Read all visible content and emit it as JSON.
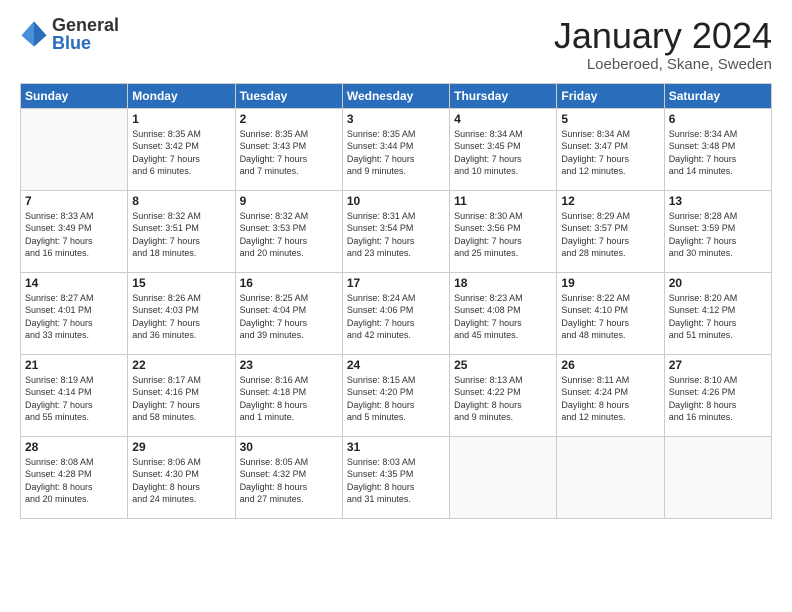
{
  "header": {
    "logo_general": "General",
    "logo_blue": "Blue",
    "month_title": "January 2024",
    "location": "Loeberoed, Skane, Sweden"
  },
  "days_of_week": [
    "Sunday",
    "Monday",
    "Tuesday",
    "Wednesday",
    "Thursday",
    "Friday",
    "Saturday"
  ],
  "weeks": [
    [
      {
        "day": "",
        "info": ""
      },
      {
        "day": "1",
        "info": "Sunrise: 8:35 AM\nSunset: 3:42 PM\nDaylight: 7 hours\nand 6 minutes."
      },
      {
        "day": "2",
        "info": "Sunrise: 8:35 AM\nSunset: 3:43 PM\nDaylight: 7 hours\nand 7 minutes."
      },
      {
        "day": "3",
        "info": "Sunrise: 8:35 AM\nSunset: 3:44 PM\nDaylight: 7 hours\nand 9 minutes."
      },
      {
        "day": "4",
        "info": "Sunrise: 8:34 AM\nSunset: 3:45 PM\nDaylight: 7 hours\nand 10 minutes."
      },
      {
        "day": "5",
        "info": "Sunrise: 8:34 AM\nSunset: 3:47 PM\nDaylight: 7 hours\nand 12 minutes."
      },
      {
        "day": "6",
        "info": "Sunrise: 8:34 AM\nSunset: 3:48 PM\nDaylight: 7 hours\nand 14 minutes."
      }
    ],
    [
      {
        "day": "7",
        "info": "Sunrise: 8:33 AM\nSunset: 3:49 PM\nDaylight: 7 hours\nand 16 minutes."
      },
      {
        "day": "8",
        "info": "Sunrise: 8:32 AM\nSunset: 3:51 PM\nDaylight: 7 hours\nand 18 minutes."
      },
      {
        "day": "9",
        "info": "Sunrise: 8:32 AM\nSunset: 3:53 PM\nDaylight: 7 hours\nand 20 minutes."
      },
      {
        "day": "10",
        "info": "Sunrise: 8:31 AM\nSunset: 3:54 PM\nDaylight: 7 hours\nand 23 minutes."
      },
      {
        "day": "11",
        "info": "Sunrise: 8:30 AM\nSunset: 3:56 PM\nDaylight: 7 hours\nand 25 minutes."
      },
      {
        "day": "12",
        "info": "Sunrise: 8:29 AM\nSunset: 3:57 PM\nDaylight: 7 hours\nand 28 minutes."
      },
      {
        "day": "13",
        "info": "Sunrise: 8:28 AM\nSunset: 3:59 PM\nDaylight: 7 hours\nand 30 minutes."
      }
    ],
    [
      {
        "day": "14",
        "info": "Sunrise: 8:27 AM\nSunset: 4:01 PM\nDaylight: 7 hours\nand 33 minutes."
      },
      {
        "day": "15",
        "info": "Sunrise: 8:26 AM\nSunset: 4:03 PM\nDaylight: 7 hours\nand 36 minutes."
      },
      {
        "day": "16",
        "info": "Sunrise: 8:25 AM\nSunset: 4:04 PM\nDaylight: 7 hours\nand 39 minutes."
      },
      {
        "day": "17",
        "info": "Sunrise: 8:24 AM\nSunset: 4:06 PM\nDaylight: 7 hours\nand 42 minutes."
      },
      {
        "day": "18",
        "info": "Sunrise: 8:23 AM\nSunset: 4:08 PM\nDaylight: 7 hours\nand 45 minutes."
      },
      {
        "day": "19",
        "info": "Sunrise: 8:22 AM\nSunset: 4:10 PM\nDaylight: 7 hours\nand 48 minutes."
      },
      {
        "day": "20",
        "info": "Sunrise: 8:20 AM\nSunset: 4:12 PM\nDaylight: 7 hours\nand 51 minutes."
      }
    ],
    [
      {
        "day": "21",
        "info": "Sunrise: 8:19 AM\nSunset: 4:14 PM\nDaylight: 7 hours\nand 55 minutes."
      },
      {
        "day": "22",
        "info": "Sunrise: 8:17 AM\nSunset: 4:16 PM\nDaylight: 7 hours\nand 58 minutes."
      },
      {
        "day": "23",
        "info": "Sunrise: 8:16 AM\nSunset: 4:18 PM\nDaylight: 8 hours\nand 1 minute."
      },
      {
        "day": "24",
        "info": "Sunrise: 8:15 AM\nSunset: 4:20 PM\nDaylight: 8 hours\nand 5 minutes."
      },
      {
        "day": "25",
        "info": "Sunrise: 8:13 AM\nSunset: 4:22 PM\nDaylight: 8 hours\nand 9 minutes."
      },
      {
        "day": "26",
        "info": "Sunrise: 8:11 AM\nSunset: 4:24 PM\nDaylight: 8 hours\nand 12 minutes."
      },
      {
        "day": "27",
        "info": "Sunrise: 8:10 AM\nSunset: 4:26 PM\nDaylight: 8 hours\nand 16 minutes."
      }
    ],
    [
      {
        "day": "28",
        "info": "Sunrise: 8:08 AM\nSunset: 4:28 PM\nDaylight: 8 hours\nand 20 minutes."
      },
      {
        "day": "29",
        "info": "Sunrise: 8:06 AM\nSunset: 4:30 PM\nDaylight: 8 hours\nand 24 minutes."
      },
      {
        "day": "30",
        "info": "Sunrise: 8:05 AM\nSunset: 4:32 PM\nDaylight: 8 hours\nand 27 minutes."
      },
      {
        "day": "31",
        "info": "Sunrise: 8:03 AM\nSunset: 4:35 PM\nDaylight: 8 hours\nand 31 minutes."
      },
      {
        "day": "",
        "info": ""
      },
      {
        "day": "",
        "info": ""
      },
      {
        "day": "",
        "info": ""
      }
    ]
  ]
}
